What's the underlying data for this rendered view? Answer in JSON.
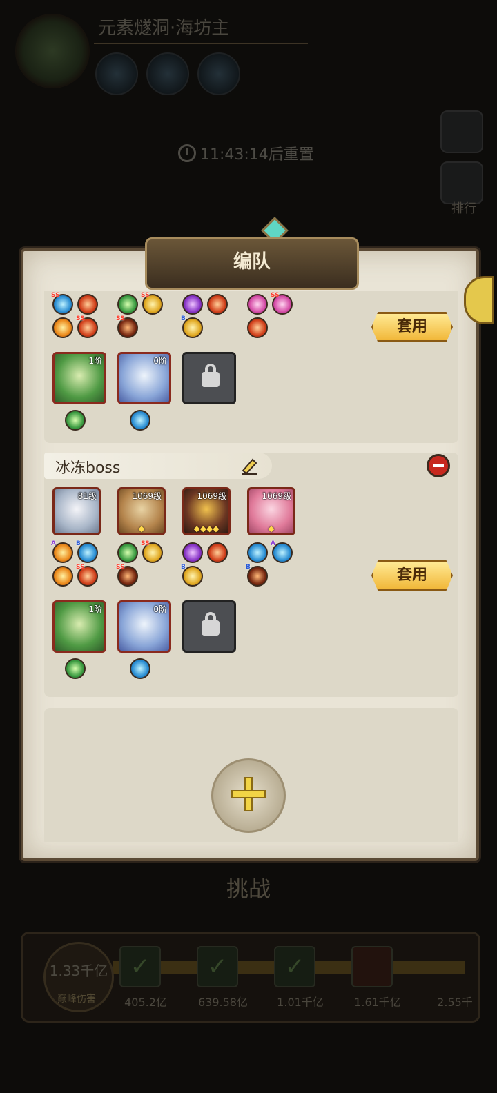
{
  "background": {
    "boss_title": "元素燧洞·海坊主",
    "reset_timer": "11:43:14后重置",
    "rank_label": "排行",
    "challenge_label": "挑战",
    "damage": {
      "peak_value": "1.33千亿",
      "peak_label": "巅峰伤害",
      "stage_values": [
        "405.2亿",
        "639.58亿",
        "1.01千亿",
        "1.61千亿",
        "2.55千"
      ]
    }
  },
  "modal": {
    "title": "编队",
    "apply_label": "套用",
    "teams": [
      {
        "name": "",
        "heroes": [],
        "pets": [
          {
            "level": "1阶",
            "kind": "h-plant"
          },
          {
            "level": "0阶",
            "kind": "h-siren"
          },
          {
            "level": "",
            "kind": "locked"
          }
        ]
      },
      {
        "name": "冰冻boss",
        "heroes": [
          {
            "level": "81级",
            "kind": "h-dragon",
            "stars": ""
          },
          {
            "level": "1069级",
            "kind": "h-beast",
            "stars": "◆"
          },
          {
            "level": "1069级",
            "kind": "h-demon",
            "stars": "◆◆◆◆"
          },
          {
            "level": "1069级",
            "kind": "h-fairy",
            "stars": "◆"
          }
        ],
        "pets": [
          {
            "level": "1阶",
            "kind": "h-plant"
          },
          {
            "level": "0阶",
            "kind": "h-siren"
          },
          {
            "level": "",
            "kind": "locked"
          }
        ]
      }
    ]
  }
}
